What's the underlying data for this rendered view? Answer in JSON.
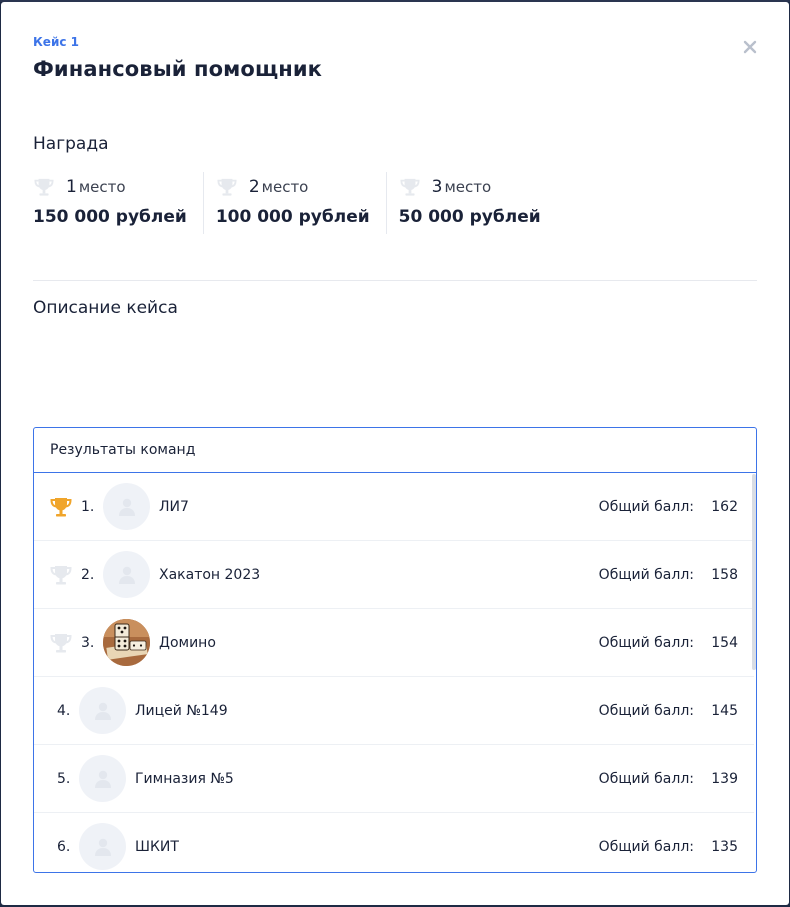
{
  "case": {
    "label": "Кейс 1",
    "title": "Финансовый помощник"
  },
  "close_icon": "close-icon",
  "reward": {
    "heading": "Награда",
    "place_word": "место",
    "prizes": [
      {
        "place": "1",
        "amount": "150 000 рублей"
      },
      {
        "place": "2",
        "amount": "100 000 рублей"
      },
      {
        "place": "3",
        "amount": "50 000 рублей"
      }
    ]
  },
  "description": {
    "heading": "Описание кейса"
  },
  "results": {
    "heading": "Результаты команд",
    "score_label": "Общий балл:",
    "teams": [
      {
        "rank": "1.",
        "name": "ЛИ7",
        "score": "162",
        "trophy": "gold"
      },
      {
        "rank": "2.",
        "name": "Хакатон 2023",
        "score": "158",
        "trophy": "gray"
      },
      {
        "rank": "3.",
        "name": "Домино",
        "score": "154",
        "trophy": "gray"
      },
      {
        "rank": "4.",
        "name": "Лицей №149",
        "score": "145"
      },
      {
        "rank": "5.",
        "name": "Гимназия №5",
        "score": "139"
      },
      {
        "rank": "6.",
        "name": "ШКИТ",
        "score": "135"
      }
    ]
  },
  "colors": {
    "accent": "#3d74e8",
    "gold_trophy": "#f0a52b",
    "gray_trophy": "#e6e9ee"
  }
}
